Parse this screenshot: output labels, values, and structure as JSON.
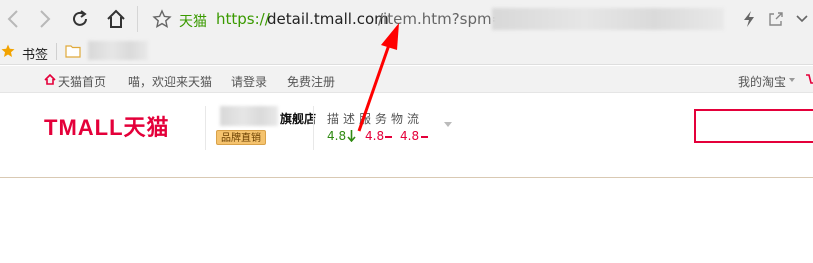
{
  "browser": {
    "address": {
      "site_label": "天猫",
      "url_scheme": "https://",
      "url_host": "detail.tmall.com",
      "url_path": "/item.htm?spm=a"
    }
  },
  "bookmarks": {
    "label": "书签"
  },
  "site_nav": {
    "home": "天猫首页",
    "welcome": "喵，欢迎来天猫",
    "login": "请登录",
    "register": "免费注册",
    "my_taobao": "我的淘宝"
  },
  "header": {
    "logo": "TMALL天猫",
    "shop_name_suffix": "旗舰店",
    "badge": "品牌直销",
    "rating_heading": "描述服务物流",
    "scores": [
      "4.8",
      "4.8",
      "4.8"
    ],
    "score_colors": [
      "#2f8a12",
      "#e4003a",
      "#e4003a"
    ]
  },
  "colors": {
    "brand": "#e4003a",
    "url_green": "#3a9a00",
    "annotation_arrow": "#ff0000"
  }
}
